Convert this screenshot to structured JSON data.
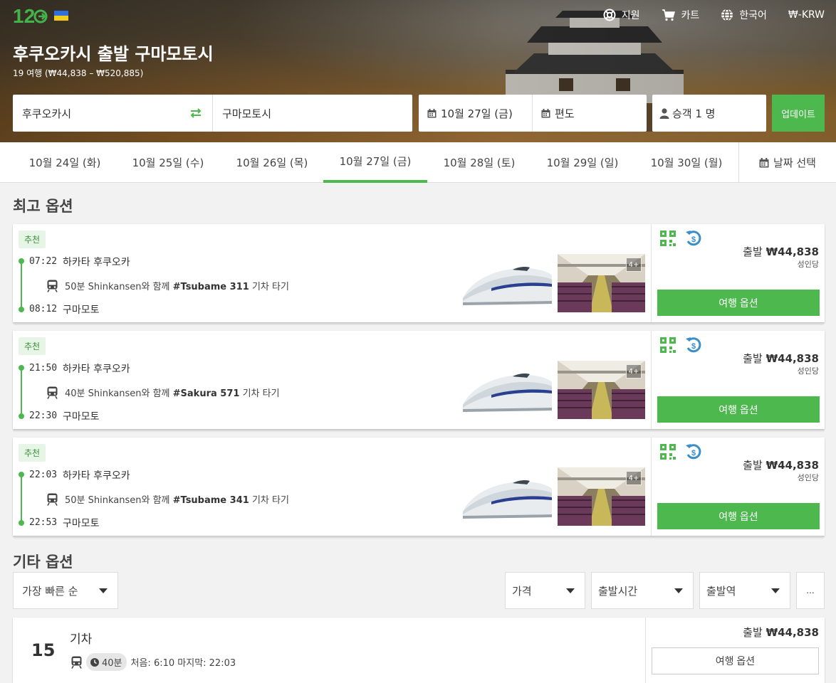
{
  "header": {
    "logo": "12GO",
    "nav": [
      {
        "label": "지원",
        "icon": "lifebuoy-icon"
      },
      {
        "label": "카트",
        "icon": "cart-icon"
      },
      {
        "label": "한국어",
        "icon": "globe-icon"
      },
      {
        "label": "₩-KRW",
        "icon": ""
      }
    ],
    "title": "후쿠오카시 출발 구마모토시",
    "subtitle": "19 여행 (₩44,838 – ₩520,885)"
  },
  "search": {
    "from": "후쿠오카시",
    "to": "구마모토시",
    "date": "10월 27일 (금)",
    "return": "편도",
    "passengers": "승객 1 명",
    "update_label": "업데이트"
  },
  "dates": {
    "tabs": [
      "10월 24일 (화)",
      "10월 25일 (수)",
      "10월 26일 (목)",
      "10월 27일 (금)",
      "10월 28일 (토)",
      "10월 29일 (일)",
      "10월 30일 (월)"
    ],
    "active_index": 3,
    "pick_label": "날짜 선택"
  },
  "best": {
    "heading": "최고 옵션",
    "trips": [
      {
        "badge": "추천",
        "depart_time": "07:22",
        "depart_station": "하카타 후쿠오카",
        "duration": "50분 Shinkansen와 함께",
        "train": "#Tsubame 311",
        "suffix": "기차 타기",
        "arrive_time": "08:12",
        "arrive_station": "구마모토",
        "price_prefix": "출발",
        "price": "₩44,838",
        "per": "성인당",
        "photos": "4+",
        "button": "여행 옵션"
      },
      {
        "badge": "추천",
        "depart_time": "21:50",
        "depart_station": "하카타 후쿠오카",
        "duration": "40분 Shinkansen와 함께",
        "train": "#Sakura 571",
        "suffix": "기차 타기",
        "arrive_time": "22:30",
        "arrive_station": "구마모토",
        "price_prefix": "출발",
        "price": "₩44,838",
        "per": "성인당",
        "photos": "4+",
        "button": "여행 옵션"
      },
      {
        "badge": "추천",
        "depart_time": "22:03",
        "depart_station": "하카타 후쿠오카",
        "duration": "50분 Shinkansen와 함께",
        "train": "#Tsubame 341",
        "suffix": "기차 타기",
        "arrive_time": "22:53",
        "arrive_station": "구마모토",
        "price_prefix": "출발",
        "price": "₩44,838",
        "per": "성인당",
        "photos": "4+",
        "button": "여행 옵션"
      }
    ]
  },
  "other": {
    "heading": "기타 옵션",
    "sort": "가장 빠른 순",
    "filters": [
      "가격",
      "출발시간",
      "출발역"
    ],
    "more": "...",
    "result": {
      "count": "15",
      "title": "기차",
      "duration": "40분",
      "info": "처음: 6:10 마지막: 22:03",
      "price_prefix": "출발",
      "price": "₩44,838",
      "button": "여행 옵션"
    }
  },
  "colors": {
    "accent": "#4db84d",
    "refund": "#3a8fc8"
  }
}
